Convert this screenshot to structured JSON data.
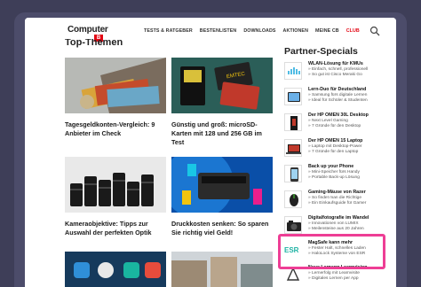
{
  "brand": {
    "name": "Computer",
    "badge": "B"
  },
  "nav": {
    "items": [
      {
        "label": "TESTS & RATGEBER",
        "active": false
      },
      {
        "label": "BESTENLISTEN",
        "active": false
      },
      {
        "label": "DOWNLOADS",
        "active": false
      },
      {
        "label": "AKTIONEN",
        "active": false
      },
      {
        "label": "MEINE CB",
        "active": false
      },
      {
        "label": "CLUB",
        "active": true
      }
    ]
  },
  "main": {
    "title": "Top-Themen",
    "cards": [
      {
        "caption": "Tagesgeldkonten-Vergleich: 9 Anbieter im Check",
        "image": "money-hand-photo"
      },
      {
        "caption": "Günstig und groß: microSD-Karten mit 128 und 256 GB im Test",
        "image": "sd-cards-photo"
      },
      {
        "caption": "Kameraobjektive: Tipps zur Auswahl der perfekten Optik",
        "image": "camera-lenses-photo"
      },
      {
        "caption": "Druckkosten senken: So sparen Sie richtig viel Geld!",
        "image": "printer-ink-photo"
      }
    ]
  },
  "sidebar": {
    "title": "Partner-Specials",
    "items": [
      {
        "title": "WLAN-Lösung für KMUs",
        "lines": [
          "» Einfach, schnell, professionell",
          "» So gut ist Cisco Meraki Go"
        ],
        "icon": "cisco-logo"
      },
      {
        "title": "Lern-Duo für Deutschland",
        "lines": [
          "» Samsung fürs digitale Lernen",
          "» Ideal für Schüler & Studenten"
        ],
        "icon": "samsung-tablet"
      },
      {
        "title": "Der HP OMEN 30L Desktop",
        "lines": [
          "» Next Level Gaming",
          "» 7 Gründe für den Desktop"
        ],
        "icon": "hp-desktop"
      },
      {
        "title": "Der HP OMEN 15 Laptop",
        "lines": [
          "» Laptop mit Desktop-Power",
          "» 7 Gründe für den Laptop"
        ],
        "icon": "hp-laptop"
      },
      {
        "title": "Back up your Phone",
        "lines": [
          "» Mini-Speicher fürs Handy",
          "» Portable Back-up Lösung"
        ],
        "icon": "phone-backup"
      },
      {
        "title": "Gaming-Mäuse von Razer",
        "lines": [
          "» So findet man die Richtige",
          "» Ein Einkaufsguide für Gamer"
        ],
        "icon": "razer-mouse"
      },
      {
        "title": "Digitalfotografie im Wandel",
        "lines": [
          "» Innovationen von LUMIX",
          "» Meilensteine aus 20 Jahren"
        ],
        "icon": "lumix-camera"
      },
      {
        "title": "MagSafe kann mehr",
        "lines": [
          "» Fester Halt, schnelles Laden",
          "» HaloLock Systeme von ESR"
        ],
        "icon": "esr-logo"
      },
      {
        "title": "Neue Lernapp Learnvision",
        "lines": [
          "» Lernerfolg mit Learnvisite",
          "» Digitales Lernen per App"
        ],
        "icon": "learnvision-logo"
      }
    ]
  }
}
